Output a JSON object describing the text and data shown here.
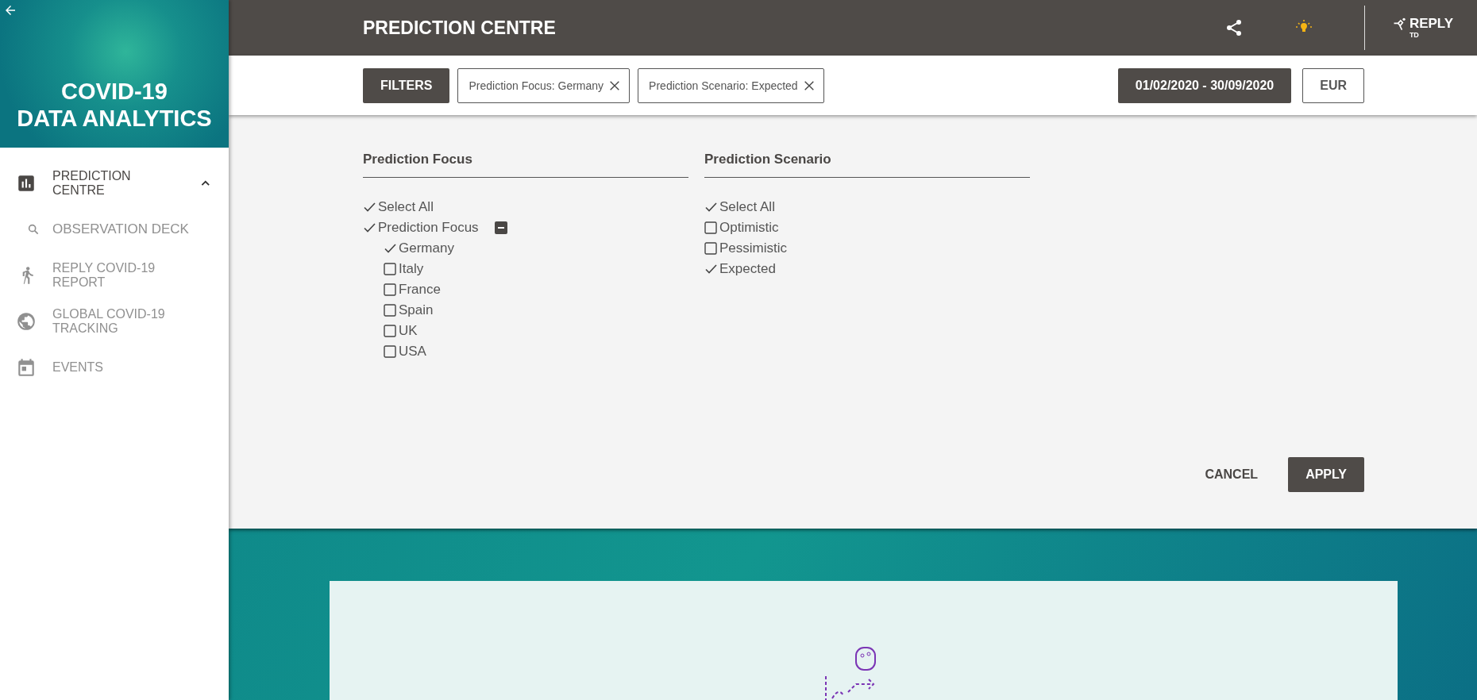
{
  "sidebar": {
    "title_lines": [
      "COVID-19",
      "DATA ANALYTICS"
    ],
    "items": [
      {
        "label": "PREDICTION CENTRE",
        "selected": true,
        "expanded": true,
        "children": [
          {
            "label": "OBSERVATION DECK",
            "selected": false
          }
        ]
      },
      {
        "label": "REPLY COVID-19 REPORT",
        "selected": false
      },
      {
        "label": "GLOBAL COVID-19 TRACKING",
        "selected": false
      },
      {
        "label": "EVENTS",
        "selected": false
      }
    ]
  },
  "header": {
    "title": "PREDICTION CENTRE",
    "logo": {
      "name": "REPLY",
      "sub": "TD"
    }
  },
  "filter_bar": {
    "filters_button": "FILTERS",
    "chips": [
      "Prediction Focus: Germany",
      "Prediction Scenario: Expected"
    ],
    "date_range": "01/02/2020 - 30/09/2020",
    "currency": "EUR"
  },
  "filter_panel": {
    "groups": [
      {
        "title": "Prediction Focus",
        "options": [
          {
            "label": "Select All",
            "checked": true
          },
          {
            "label": "Prediction Focus",
            "checked": true,
            "expanded": true,
            "children": [
              {
                "label": "Germany",
                "checked": true
              },
              {
                "label": "Italy",
                "checked": false
              },
              {
                "label": "France",
                "checked": false
              },
              {
                "label": "Spain",
                "checked": false
              },
              {
                "label": "UK",
                "checked": false
              },
              {
                "label": "USA",
                "checked": false
              }
            ]
          }
        ]
      },
      {
        "title": "Prediction Scenario",
        "options": [
          {
            "label": "Select All",
            "checked": true
          },
          {
            "label": "Optimistic",
            "checked": false
          },
          {
            "label": "Pessimistic",
            "checked": false
          },
          {
            "label": "Expected",
            "checked": true
          }
        ]
      }
    ],
    "cancel": "CANCEL",
    "apply": "APPLY"
  }
}
